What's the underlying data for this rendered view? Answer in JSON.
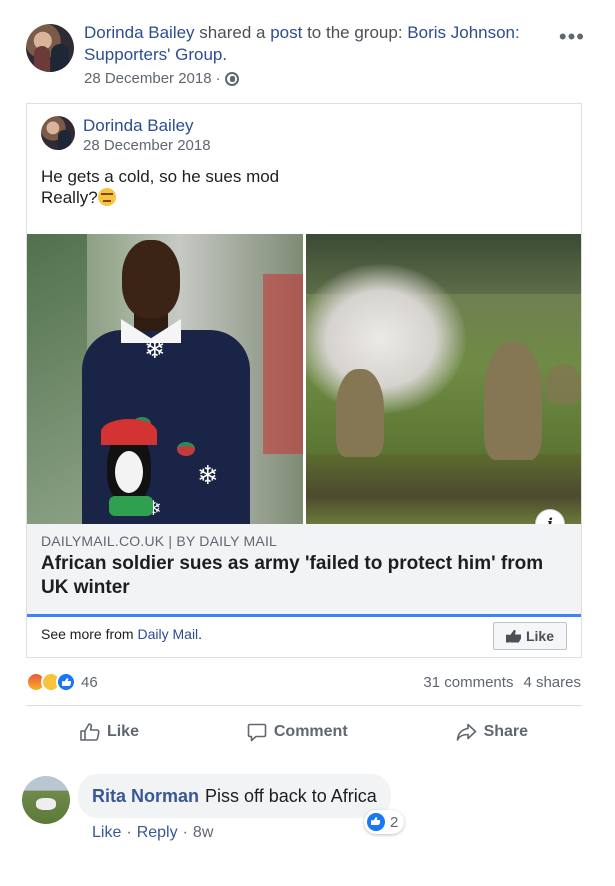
{
  "post": {
    "author": "Dorinda Bailey",
    "action_text": "shared a",
    "post_link": "post",
    "to_group_text": "to the group:",
    "group_name": "Boris Johnson: Supporters' Group.",
    "date": "28 December 2018",
    "separator": "·"
  },
  "shared": {
    "author": "Dorinda Bailey",
    "date": "28 December 2018",
    "line1": "He gets a cold, so he sues mod",
    "line2": "Really?"
  },
  "article": {
    "source_domain": "DAILYMAIL.CO.UK",
    "source_sep": "|",
    "by_label": "BY",
    "publisher": "DAILY MAIL",
    "title": "African soldier sues as army 'failed to protect him' from UK winter",
    "see_more_text": "See more from",
    "see_more_link": "Daily Mail",
    "see_more_period": ".",
    "like_page_label": "Like",
    "info_glyph": "i"
  },
  "stats": {
    "reaction_count": "46",
    "comments": "31 comments",
    "shares": "4 shares",
    "reaction_icons": [
      "angry-icon",
      "haha-icon",
      "like-icon"
    ]
  },
  "actions": {
    "like": "Like",
    "comment": "Comment",
    "share": "Share"
  },
  "comment": {
    "author": "Rita Norman",
    "text": "Piss off back to Africa",
    "like_label": "Like",
    "reply_label": "Reply",
    "age": "8w",
    "dot": "·",
    "reaction_count": "2"
  },
  "icons": {
    "more": "•••"
  },
  "colors": {
    "link_blue": "#2d4d92",
    "accent_blue": "#4080ff",
    "like_blue": "#1877f2",
    "muted_text": "#606770"
  }
}
